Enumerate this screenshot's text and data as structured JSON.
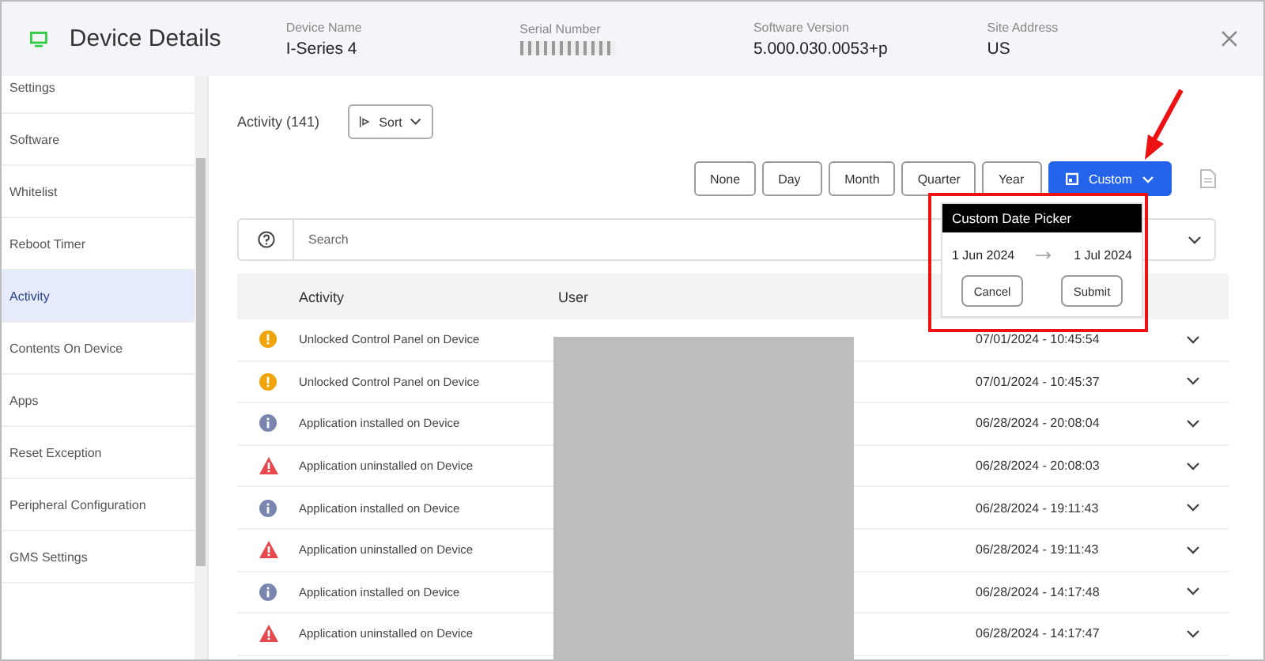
{
  "header": {
    "title": "Device Details",
    "fields": [
      {
        "label": "Device Name",
        "value": "I-Series 4"
      },
      {
        "label": "Serial Number",
        "redacted": true
      },
      {
        "label": "Software Version",
        "value": "5.000.030.0053+p"
      },
      {
        "label": "Site Address",
        "value": "US"
      }
    ]
  },
  "sidebar": {
    "items": [
      {
        "label": "Settings",
        "selected": false
      },
      {
        "label": "Software",
        "selected": false
      },
      {
        "label": "Whitelist",
        "selected": false
      },
      {
        "label": "Reboot Timer",
        "selected": false
      },
      {
        "label": "Activity",
        "selected": true
      },
      {
        "label": "Contents On Device",
        "selected": false
      },
      {
        "label": "Apps",
        "selected": false
      },
      {
        "label": "Reset Exception",
        "selected": false
      },
      {
        "label": "Peripheral Configuration",
        "selected": false
      },
      {
        "label": "GMS Settings",
        "selected": false
      }
    ]
  },
  "activity": {
    "title": "Activity (141)",
    "sort_label": "Sort"
  },
  "periods": [
    {
      "label": "None",
      "selected": false
    },
    {
      "label": "Day",
      "selected": false
    },
    {
      "label": "Month",
      "selected": false
    },
    {
      "label": "Quarter",
      "selected": false
    },
    {
      "label": "Year",
      "selected": false
    },
    {
      "label": "Custom",
      "selected": true
    }
  ],
  "search": {
    "placeholder": "Search"
  },
  "date_picker": {
    "title": "Custom Date Picker",
    "from": "1 Jun 2024",
    "to": "1 Jul 2024",
    "buttons": [
      "Cancel",
      "Submit"
    ]
  },
  "table": {
    "columns": [
      "Activity",
      "User"
    ],
    "rows": [
      {
        "kind": "warning",
        "activity": "Unlocked Control Panel on Device",
        "date": "07/01/2024 - 10:45:54"
      },
      {
        "kind": "warning",
        "activity": "Unlocked Control Panel on Device",
        "date": "07/01/2024 - 10:45:37"
      },
      {
        "kind": "info",
        "activity": "Application installed on Device",
        "date": "06/28/2024 - 20:08:04"
      },
      {
        "kind": "alert",
        "activity": "Application uninstalled on Device",
        "date": "06/28/2024 - 20:08:03"
      },
      {
        "kind": "info",
        "activity": "Application installed on Device",
        "date": "06/28/2024 - 19:11:43"
      },
      {
        "kind": "alert",
        "activity": "Application uninstalled on Device",
        "date": "06/28/2024 - 19:11:43"
      },
      {
        "kind": "info",
        "activity": "Application installed on Device",
        "date": "06/28/2024 - 14:17:48"
      },
      {
        "kind": "alert",
        "activity": "Application uninstalled on Device",
        "date": "06/28/2024 - 14:17:47"
      }
    ]
  }
}
